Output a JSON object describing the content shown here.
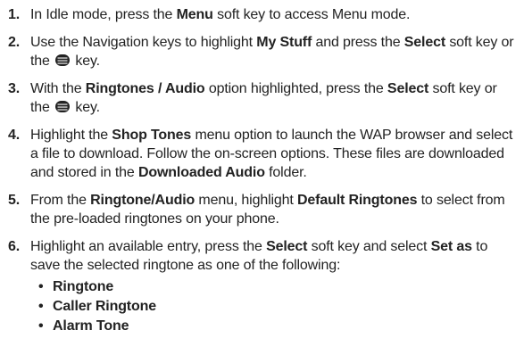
{
  "steps": [
    {
      "number": "1.",
      "segments": [
        {
          "text": "In Idle mode, press the "
        },
        {
          "text": "Menu",
          "bold": true
        },
        {
          "text": " soft key to access Menu mode."
        }
      ]
    },
    {
      "number": "2.",
      "segments": [
        {
          "text": "Use the Navigation keys to highlight "
        },
        {
          "text": "My Stuff",
          "bold": true
        },
        {
          "text": " and press the "
        },
        {
          "text": "Select",
          "bold": true
        },
        {
          "text": " soft key or the "
        },
        {
          "icon": "select-key-icon"
        },
        {
          "text": " key."
        }
      ]
    },
    {
      "number": "3.",
      "segments": [
        {
          "text": "With the "
        },
        {
          "text": "Ringtones / Audio",
          "bold": true
        },
        {
          "text": " option highlighted, press the "
        },
        {
          "text": "Select",
          "bold": true
        },
        {
          "text": " soft key or the "
        },
        {
          "icon": "select-key-icon"
        },
        {
          "text": " key."
        }
      ]
    },
    {
      "number": "4.",
      "segments": [
        {
          "text": "Highlight the "
        },
        {
          "text": "Shop Tones",
          "bold": true
        },
        {
          "text": " menu option to launch the WAP browser and select a file to download. Follow the on-screen options. These files are downloaded and stored in the "
        },
        {
          "text": "Downloaded Audio",
          "bold": true
        },
        {
          "text": " folder."
        }
      ]
    },
    {
      "number": "5.",
      "segments": [
        {
          "text": "From the "
        },
        {
          "text": "Ringtone/Audio",
          "bold": true
        },
        {
          "text": " menu, highlight "
        },
        {
          "text": "Default Ringtones",
          "bold": true
        },
        {
          "text": " to select from the pre-loaded ringtones on your phone."
        }
      ]
    },
    {
      "number": "6.",
      "segments": [
        {
          "text": "Highlight an available entry, press the "
        },
        {
          "text": "Select",
          "bold": true
        },
        {
          "text": " soft key and select "
        },
        {
          "text": "Set as",
          "bold": true
        },
        {
          "text": " to save the selected ringtone as one of the following:"
        }
      ],
      "options": [
        "Ringtone",
        "Caller Ringtone",
        "Alarm Tone"
      ]
    }
  ],
  "bullet_glyph": "•",
  "icon_color": "#222222"
}
